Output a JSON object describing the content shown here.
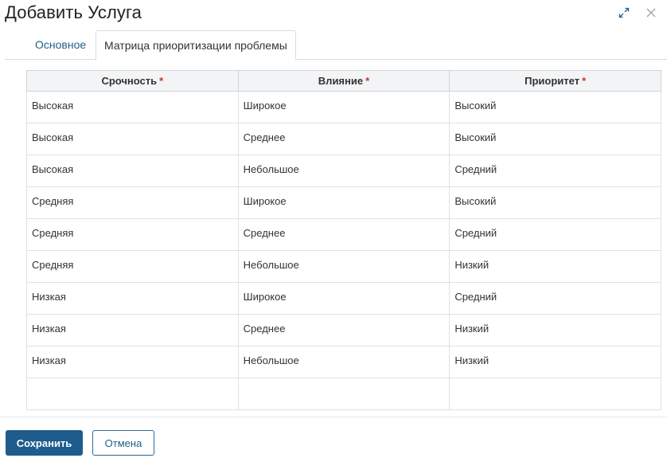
{
  "dialog": {
    "title": "Добавить Услуга"
  },
  "tabs": [
    {
      "label": "Основное"
    },
    {
      "label": "Матрица приоритизации проблемы"
    }
  ],
  "table": {
    "columns": [
      {
        "label": "Срочность",
        "required_mark": "*"
      },
      {
        "label": "Влияние",
        "required_mark": "*"
      },
      {
        "label": "Приоритет",
        "required_mark": "*"
      }
    ],
    "rows": [
      [
        "Высокая",
        "Широкое",
        "Высокий"
      ],
      [
        "Высокая",
        "Среднее",
        "Высокий"
      ],
      [
        "Высокая",
        "Небольшое",
        "Средний"
      ],
      [
        "Средняя",
        "Широкое",
        "Высокий"
      ],
      [
        "Средняя",
        "Среднее",
        "Средний"
      ],
      [
        "Средняя",
        "Небольшое",
        "Низкий"
      ],
      [
        "Низкая",
        "Широкое",
        "Средний"
      ],
      [
        "Низкая",
        "Среднее",
        "Низкий"
      ],
      [
        "Низкая",
        "Небольшое",
        "Низкий"
      ],
      [
        "",
        "",
        ""
      ]
    ]
  },
  "footer": {
    "save_label": "Сохранить",
    "cancel_label": "Отмена"
  },
  "icons": {
    "expand": "expand-icon",
    "close": "close-icon"
  },
  "colors": {
    "accent": "#1e5c8e",
    "link": "#1f5f8b",
    "required": "#d32f2f"
  }
}
